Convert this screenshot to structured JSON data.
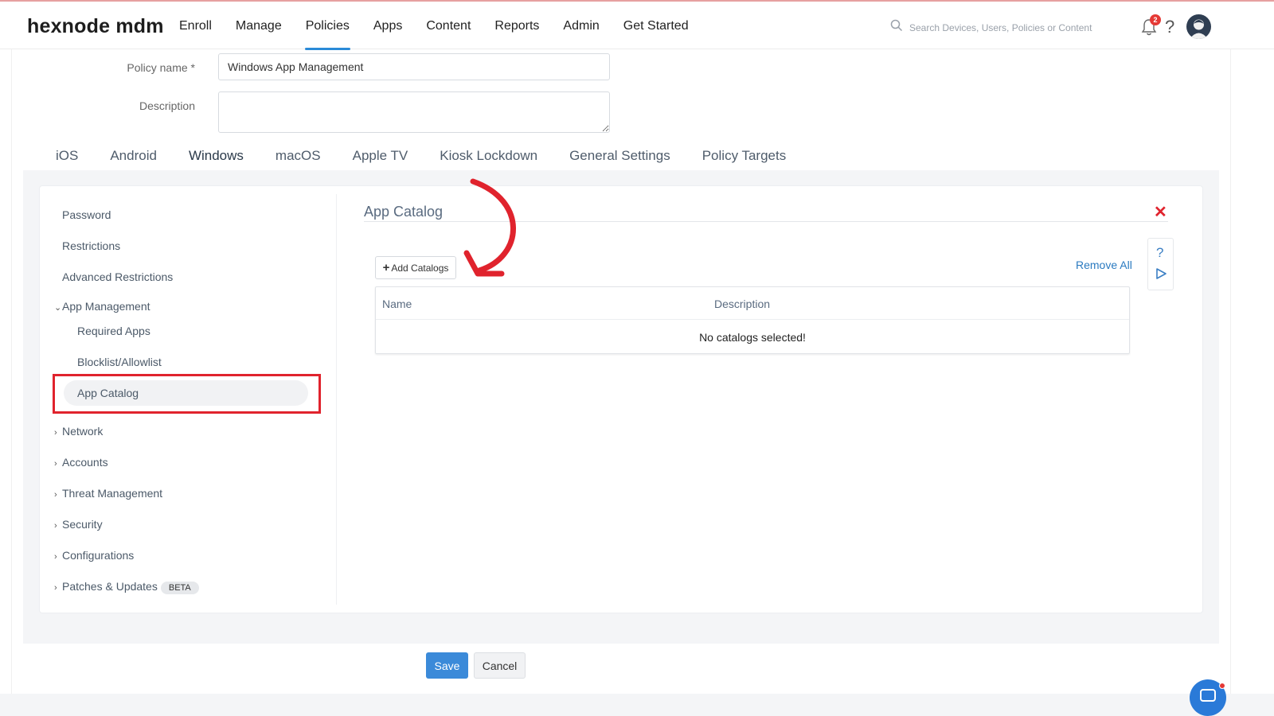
{
  "brand": {
    "logo": "hexnode mdm"
  },
  "nav": {
    "items": [
      "Enroll",
      "Manage",
      "Policies",
      "Apps",
      "Content",
      "Reports",
      "Admin",
      "Get Started"
    ],
    "active": "Policies"
  },
  "search": {
    "placeholder": "Search Devices, Users, Policies or Content"
  },
  "notifications": {
    "count": "2"
  },
  "help": {
    "label": "?"
  },
  "form": {
    "policy_name_label": "Policy name *",
    "policy_name_value": "Windows App Management",
    "description_label": "Description",
    "description_value": ""
  },
  "platform_tabs": {
    "items": [
      "iOS",
      "Android",
      "Windows",
      "macOS",
      "Apple TV",
      "Kiosk Lockdown",
      "General Settings",
      "Policy Targets"
    ],
    "active": "Windows"
  },
  "sidebar": {
    "password": "Password",
    "restrictions": "Restrictions",
    "advanced_restrictions": "Advanced Restrictions",
    "app_management": "App Management",
    "required_apps": "Required Apps",
    "blocklist": "Blocklist/Allowlist",
    "app_catalog": "App Catalog",
    "network": "Network",
    "accounts": "Accounts",
    "threat_management": "Threat Management",
    "security": "Security",
    "configurations": "Configurations",
    "patches": "Patches & Updates",
    "beta": "BETA"
  },
  "section": {
    "title": "App Catalog",
    "add_button": "Add Catalogs",
    "remove_all": "Remove All",
    "table": {
      "columns": [
        "Name",
        "Description"
      ],
      "empty_message": "No catalogs selected!"
    }
  },
  "footer": {
    "save": "Save",
    "cancel": "Cancel"
  },
  "colors": {
    "accent": "#2a8ad8",
    "highlight": "#e0232d",
    "save": "#3b8ad9"
  }
}
